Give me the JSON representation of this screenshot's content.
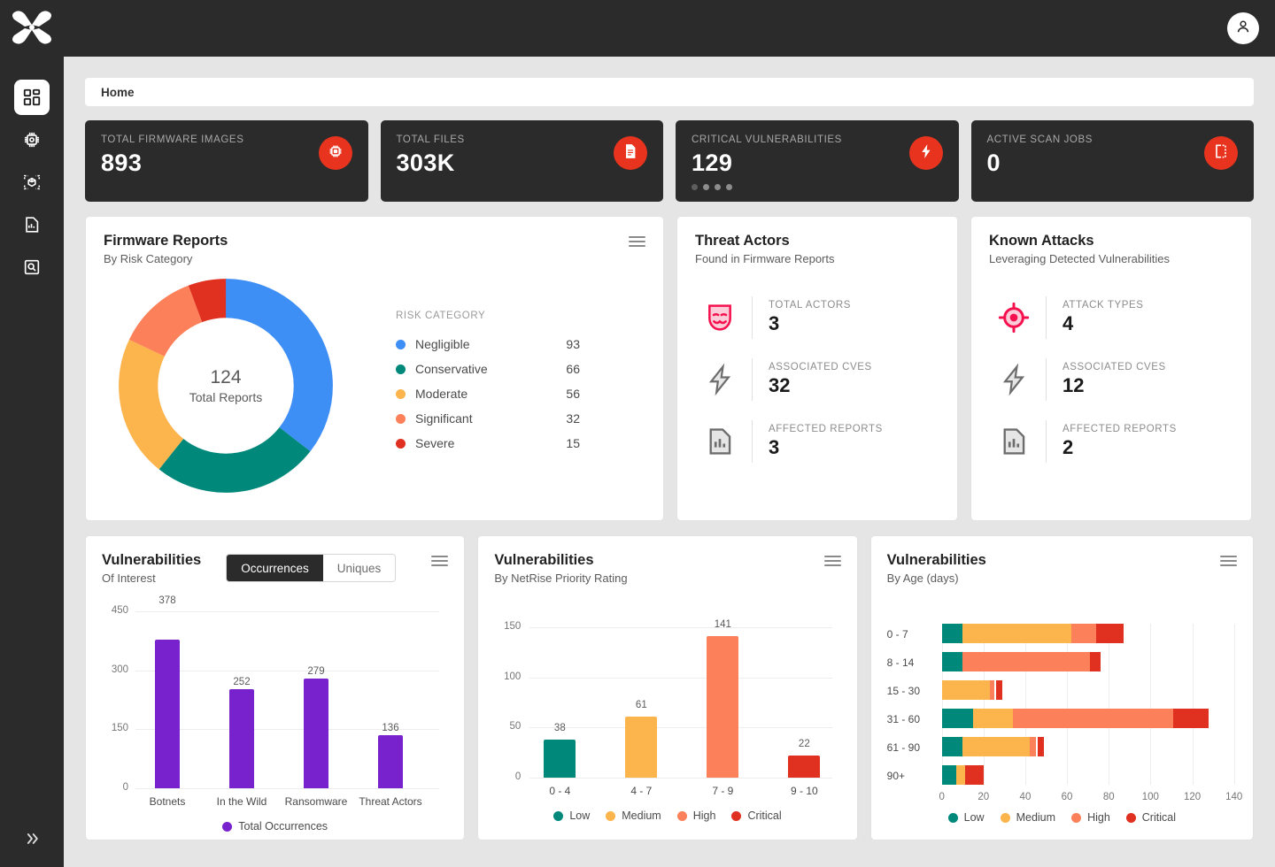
{
  "colors": {
    "brand_red": "#e8341f",
    "sidebar_bg": "#2b2b2b",
    "negligible": "#3d8ef5",
    "conservative": "#00897b",
    "moderate": "#fcb44d",
    "significant": "#fc8059",
    "severe": "#e03020",
    "purple": "#7722cc",
    "low": "#00897b",
    "medium": "#fcb44d",
    "high": "#fc8059",
    "critical": "#e03020"
  },
  "sidebar": {
    "logo_name": "netrise-logo",
    "items": [
      {
        "name": "dashboard",
        "icon": "dashboard-grid-icon",
        "active": true
      },
      {
        "name": "firmware",
        "icon": "chip-icon",
        "active": false
      },
      {
        "name": "artifacts",
        "icon": "cube-scan-icon",
        "active": false
      },
      {
        "name": "reports",
        "icon": "document-chart-icon",
        "active": false
      },
      {
        "name": "search",
        "icon": "magnifier-icon",
        "active": false
      }
    ],
    "collapse_icon": "double-chevron-right-icon"
  },
  "topbar": {
    "avatar_icon": "user-avatar-icon"
  },
  "breadcrumb": {
    "current": "Home"
  },
  "kpis": [
    {
      "label": "TOTAL FIRMWARE IMAGES",
      "value": "893",
      "icon": "chip-icon",
      "dots": 0
    },
    {
      "label": "TOTAL FILES",
      "value": "303K",
      "icon": "file-document-icon",
      "dots": 0
    },
    {
      "label": "CRITICAL VULNERABILITIES",
      "value": "129",
      "icon": "lightning-bolt-icon",
      "dots": 4,
      "active_dot": 0
    },
    {
      "label": "ACTIVE SCAN JOBS",
      "value": "0",
      "icon": "scan-frame-icon",
      "dots": 0
    }
  ],
  "firmware_reports": {
    "title": "Firmware Reports",
    "subtitle": "By Risk Category",
    "menu_icon": "hamburger-menu-icon",
    "legend_header": "RISK CATEGORY",
    "center_value": "124",
    "center_label": "Total Reports"
  },
  "threat_actors": {
    "title": "Threat Actors",
    "subtitle": "Found in Firmware Reports",
    "stats": [
      {
        "icon": "theater-mask-icon",
        "label": "TOTAL ACTORS",
        "value": "3"
      },
      {
        "icon": "lightning-bolt-icon",
        "label": "ASSOCIATED CVES",
        "value": "32"
      },
      {
        "icon": "document-chart-icon",
        "label": "AFFECTED REPORTS",
        "value": "3"
      }
    ]
  },
  "known_attacks": {
    "title": "Known Attacks",
    "subtitle": "Leveraging Detected Vulnerabilities",
    "stats": [
      {
        "icon": "crosshair-target-icon",
        "label": "ATTACK TYPES",
        "value": "4"
      },
      {
        "icon": "lightning-bolt-icon",
        "label": "ASSOCIATED CVES",
        "value": "12"
      },
      {
        "icon": "document-chart-icon",
        "label": "AFFECTED REPORTS",
        "value": "2"
      }
    ]
  },
  "vuln_interest": {
    "title": "Vulnerabilities",
    "subtitle": "Of Interest",
    "menu_icon": "hamburger-menu-icon",
    "toggle": {
      "options": [
        "Occurrences",
        "Uniques"
      ],
      "selected": "Occurrences"
    }
  },
  "vuln_priority": {
    "title": "Vulnerabilities",
    "subtitle": "By NetRise Priority Rating",
    "menu_icon": "hamburger-menu-icon"
  },
  "vuln_age": {
    "title": "Vulnerabilities",
    "subtitle": "By Age (days)",
    "menu_icon": "hamburger-menu-icon"
  },
  "chart_data": [
    {
      "id": "firmware-reports-donut",
      "type": "pie",
      "title": "Firmware Reports",
      "subtitle": "By Risk Category",
      "legend_title": "RISK CATEGORY",
      "legend_position": "right",
      "center_value": 124,
      "center_label": "Total Reports",
      "categories": [
        "Negligible",
        "Conservative",
        "Moderate",
        "Significant",
        "Severe"
      ],
      "values": [
        93,
        66,
        56,
        32,
        15
      ],
      "colors": [
        "#3d8ef5",
        "#00897b",
        "#fcb44d",
        "#fc8059",
        "#e03020"
      ]
    },
    {
      "id": "vulnerabilities-of-interest",
      "type": "bar",
      "title": "Vulnerabilities",
      "subtitle": "Of Interest",
      "categories": [
        "Botnets",
        "In the Wild",
        "Ransomware",
        "Threat Actors"
      ],
      "values": [
        378,
        252,
        279,
        136
      ],
      "series": [
        {
          "name": "Total Occurrences",
          "values": [
            378,
            252,
            279,
            136
          ],
          "color": "#7722cc"
        }
      ],
      "xlabel": "",
      "ylabel": "",
      "ylim": [
        0,
        450
      ],
      "yticks": [
        0,
        150,
        300,
        450
      ],
      "grid": true,
      "legend": [
        "Total Occurrences"
      ],
      "legend_position": "bottom"
    },
    {
      "id": "vulnerabilities-by-priority",
      "type": "bar",
      "title": "Vulnerabilities",
      "subtitle": "By NetRise Priority Rating",
      "categories": [
        "0 - 4",
        "4 - 7",
        "7 - 9",
        "9 - 10"
      ],
      "values": [
        38,
        61,
        141,
        22
      ],
      "bar_colors": [
        "#00897b",
        "#fcb44d",
        "#fc8059",
        "#e03020"
      ],
      "xlabel": "",
      "ylabel": "",
      "ylim": [
        0,
        150
      ],
      "yticks": [
        0,
        50,
        100,
        150
      ],
      "grid": true,
      "legend": [
        "Low",
        "Medium",
        "High",
        "Critical"
      ],
      "legend_colors": [
        "#00897b",
        "#fcb44d",
        "#fc8059",
        "#e03020"
      ],
      "legend_position": "bottom"
    },
    {
      "id": "vulnerabilities-by-age",
      "type": "bar",
      "orientation": "horizontal",
      "stacked": true,
      "title": "Vulnerabilities",
      "subtitle": "By Age (days)",
      "categories": [
        "0 - 7",
        "8 - 14",
        "15 - 30",
        "31 - 60",
        "61 - 90",
        "90+"
      ],
      "series": [
        {
          "name": "Low",
          "color": "#00897b",
          "values": [
            10,
            10,
            0,
            15,
            10,
            7
          ]
        },
        {
          "name": "Medium",
          "color": "#fcb44d",
          "values": [
            52,
            0,
            23,
            19,
            32,
            4
          ]
        },
        {
          "name": "High",
          "color": "#fc8059",
          "values": [
            12,
            61,
            2,
            77,
            3,
            0
          ]
        },
        {
          "name": "Critical",
          "color": "#e03020",
          "values": [
            13,
            5,
            3,
            17,
            3,
            9
          ]
        }
      ],
      "xlim": [
        0,
        140
      ],
      "xticks": [
        0,
        20,
        40,
        60,
        80,
        100,
        120,
        140
      ],
      "grid": true,
      "legend": [
        "Low",
        "Medium",
        "High",
        "Critical"
      ],
      "legend_position": "bottom"
    }
  ]
}
